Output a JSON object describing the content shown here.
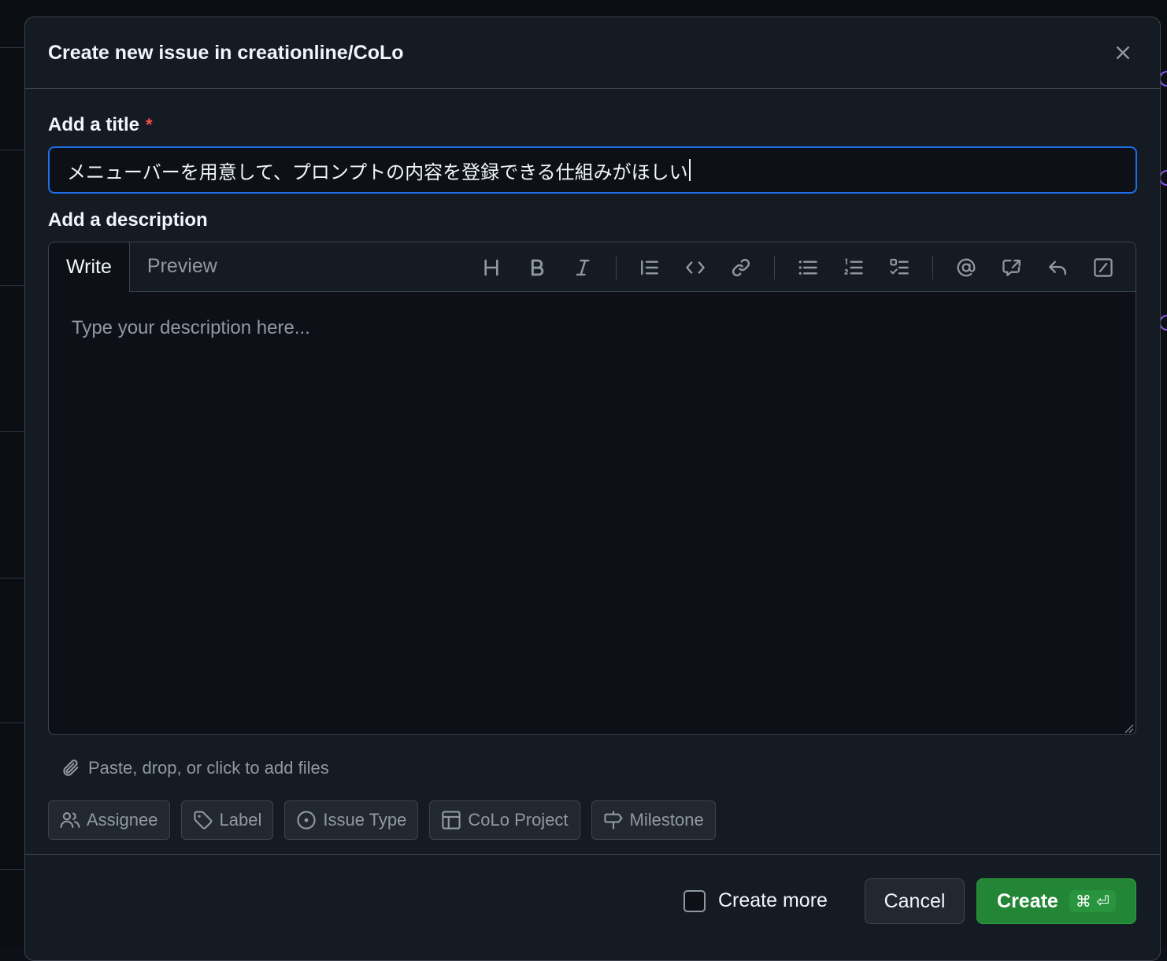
{
  "dialog": {
    "title": "Create new issue in creationline/CoLo",
    "close_icon": "x-icon"
  },
  "title_field": {
    "label": "Add a title",
    "required_marker": "*",
    "value": "メニューバーを用意して、プロンプトの内容を登録できる仕組みがほしい"
  },
  "description": {
    "label": "Add a description",
    "tabs": [
      {
        "label": "Write",
        "active": true
      },
      {
        "label": "Preview",
        "active": false
      }
    ],
    "toolbar_icons": [
      "heading-icon",
      "bold-icon",
      "italic-icon",
      "quote-icon",
      "code-icon",
      "link-icon",
      "unordered-list-icon",
      "ordered-list-icon",
      "task-list-icon",
      "mention-icon",
      "reference-icon",
      "saved-replies-icon",
      "slash-commands-icon"
    ],
    "placeholder": "Type your description here..."
  },
  "attach": {
    "label": "Paste, drop, or click to add files"
  },
  "metadata_buttons": [
    {
      "label": "Assignee",
      "icon": "people-icon"
    },
    {
      "label": "Label",
      "icon": "tag-icon"
    },
    {
      "label": "Issue Type",
      "icon": "issue-type-icon"
    },
    {
      "label": "CoLo Project",
      "icon": "table-icon"
    },
    {
      "label": "Milestone",
      "icon": "milestone-icon"
    }
  ],
  "footer": {
    "create_more_label": "Create more",
    "create_more_checked": false,
    "cancel_label": "Cancel",
    "create_label": "Create",
    "create_shortcut": "⌘ ⏎"
  },
  "colors": {
    "accent": "#1f6feb",
    "primary_button": "#238636",
    "danger": "#f85149"
  }
}
